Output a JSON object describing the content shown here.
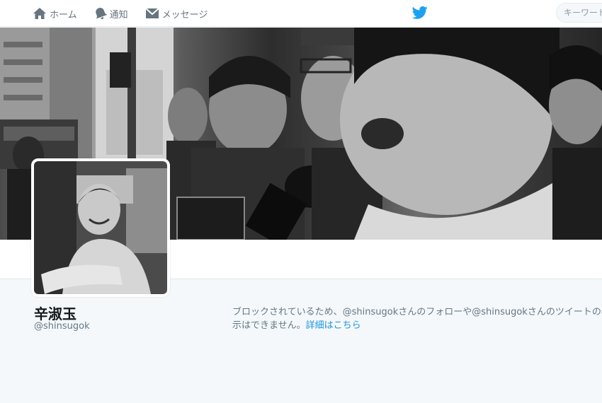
{
  "nav": {
    "home": "ホーム",
    "notifications": "通知",
    "messages": "メッセージ"
  },
  "search": {
    "placeholder": "キーワード"
  },
  "profile": {
    "name": "辛淑玉",
    "handle": "@shinsugok"
  },
  "notice": {
    "line1": "ブロックされているため、@shinsugokさんのフォローや@shinsugokさんのツイートの表",
    "line2": "示はできません。",
    "link": "詳細はこちら"
  },
  "colors": {
    "brand": "#1da1f2",
    "link": "#1b95e0",
    "muted": "#657786"
  }
}
